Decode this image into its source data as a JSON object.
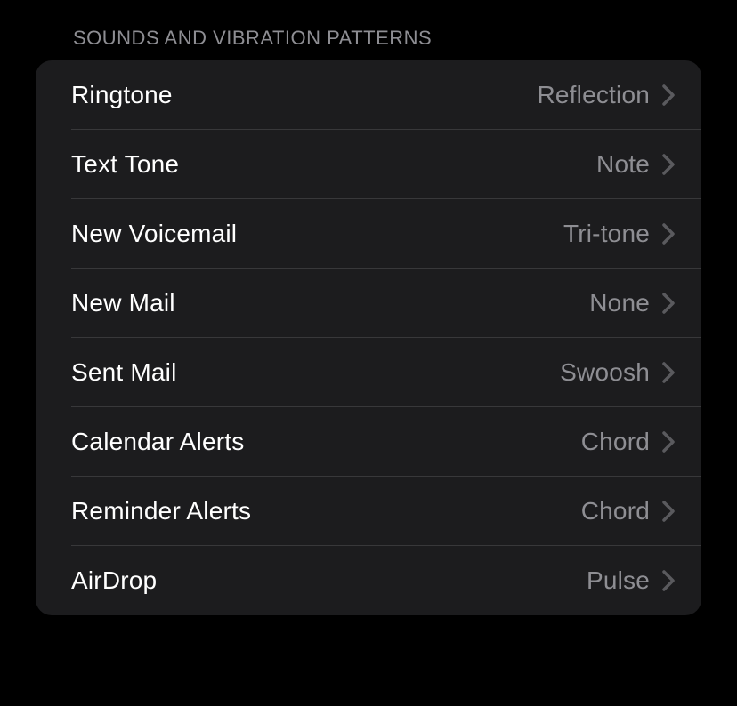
{
  "section": {
    "header": "SOUNDS AND VIBRATION PATTERNS",
    "rows": [
      {
        "label": "Ringtone",
        "value": "Reflection"
      },
      {
        "label": "Text Tone",
        "value": "Note"
      },
      {
        "label": "New Voicemail",
        "value": "Tri-tone"
      },
      {
        "label": "New Mail",
        "value": "None"
      },
      {
        "label": "Sent Mail",
        "value": "Swoosh"
      },
      {
        "label": "Calendar Alerts",
        "value": "Chord"
      },
      {
        "label": "Reminder Alerts",
        "value": "Chord"
      },
      {
        "label": "AirDrop",
        "value": "Pulse"
      }
    ]
  }
}
